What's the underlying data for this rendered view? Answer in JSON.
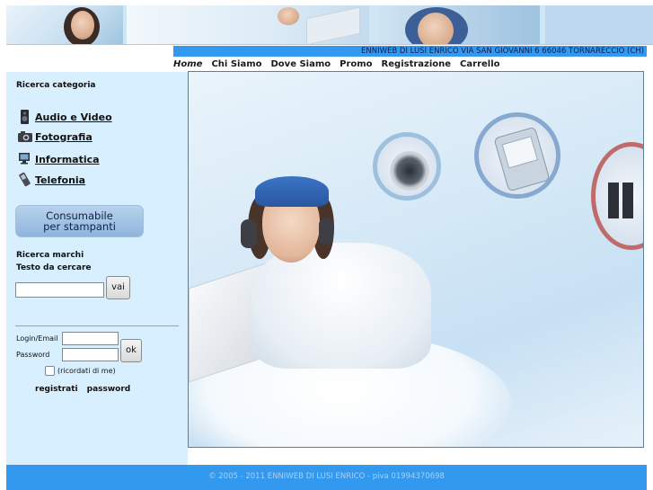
{
  "header": {
    "address": "ENNIWEB DI LUSI ENRICO VIA SAN GIOVANNI 6 66046 TORNARECCIO (CH)"
  },
  "nav": {
    "items": [
      {
        "label": "Home"
      },
      {
        "label": "Chi Siamo"
      },
      {
        "label": "Dove Siamo"
      },
      {
        "label": "Promo"
      },
      {
        "label": "Registrazione"
      },
      {
        "label": "Carrello"
      }
    ],
    "active": "Home"
  },
  "sidebar": {
    "category_title": "Ricerca categoria",
    "categories": [
      {
        "label": "Audio e Video",
        "icon": "speaker-icon"
      },
      {
        "label": "Fotografia",
        "icon": "camera-icon"
      },
      {
        "label": "Informatica",
        "icon": "computer-icon"
      },
      {
        "label": "Telefonia",
        "icon": "phone-icon"
      }
    ],
    "consumabile_line1": "Consumabile",
    "consumabile_line2": "per stampanti",
    "brand_search_title": "Ricerca marchi",
    "search_label": "Testo da cercare",
    "search_value": "",
    "search_button": "vai",
    "login_label": "Login/Email",
    "password_label": "Password",
    "login_value": "",
    "password_value": "",
    "ok_button": "ok",
    "remember_label": "(ricordati di me)",
    "register_link": "registrati",
    "password_link": "password"
  },
  "footer": {
    "text": "© 2005 - 2011 ENNIWEB DI LUSI ENRICO - piva 01994370698"
  },
  "colors": {
    "accent_blue": "#3399ee",
    "sidebar_bg": "#d8efff"
  }
}
